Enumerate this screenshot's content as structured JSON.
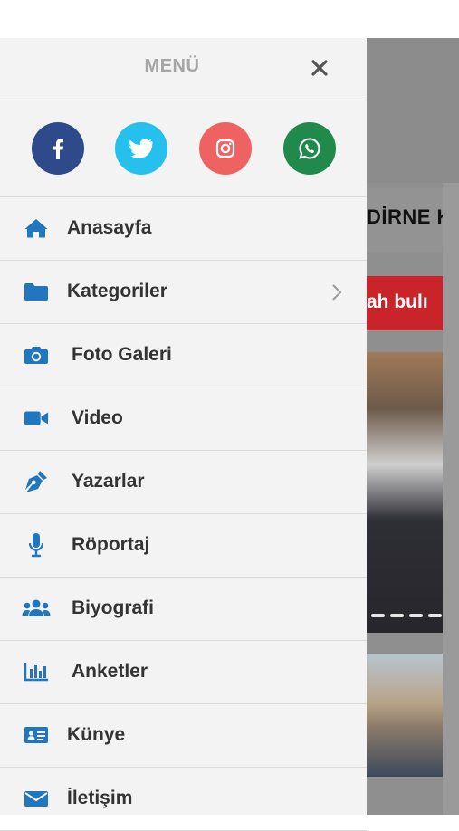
{
  "menu": {
    "title": "MENÜ"
  },
  "colors": {
    "facebook": "#2e4a8a",
    "twitter": "#25c0ee",
    "instagram": "#ef6262",
    "whatsapp": "#1f8a4c",
    "icon_blue": "#2077c0"
  },
  "social": [
    {
      "name": "facebook",
      "icon": "facebook-icon"
    },
    {
      "name": "twitter",
      "icon": "twitter-icon"
    },
    {
      "name": "instagram",
      "icon": "instagram-icon"
    },
    {
      "name": "whatsapp",
      "icon": "whatsapp-icon"
    }
  ],
  "items": [
    {
      "label": "Anasayfa",
      "icon": "home-icon"
    },
    {
      "label": "Kategoriler",
      "icon": "folder-icon",
      "has_submenu": true
    },
    {
      "label": "Foto Galeri",
      "icon": "camera-icon"
    },
    {
      "label": "Video",
      "icon": "video-icon"
    },
    {
      "label": "Yazarlar",
      "icon": "pen-icon"
    },
    {
      "label": "Röportaj",
      "icon": "microphone-icon"
    },
    {
      "label": "Biyografi",
      "icon": "users-icon"
    },
    {
      "label": "Anketler",
      "icon": "chart-icon"
    },
    {
      "label": "Künye",
      "icon": "id-card-icon"
    },
    {
      "label": "İletişim",
      "icon": "envelope-icon"
    }
  ],
  "background": {
    "nav_text": "DİRNE  K",
    "banner_text": "ah bulı"
  }
}
